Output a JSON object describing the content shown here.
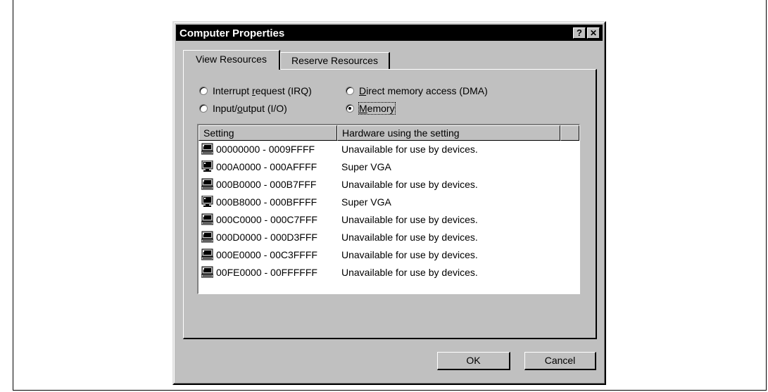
{
  "window": {
    "title": "Computer Properties",
    "help_glyph": "?",
    "close_glyph": "✕"
  },
  "tabs": [
    {
      "label": "View Resources",
      "active": true
    },
    {
      "label": "Reserve Resources",
      "active": false
    }
  ],
  "radios": {
    "irq": {
      "pre": "Interrupt ",
      "mnemonic": "r",
      "post": "equest (IRQ)",
      "checked": false
    },
    "io": {
      "pre": "Input/",
      "mnemonic": "o",
      "post": "utput (I/O)",
      "checked": false
    },
    "dma": {
      "pre": "",
      "mnemonic": "D",
      "post": "irect memory access (DMA)",
      "checked": false
    },
    "memory": {
      "pre": "",
      "mnemonic": "M",
      "post": "emory",
      "checked": true
    }
  },
  "list": {
    "columns": [
      "Setting",
      "Hardware using the setting"
    ],
    "rows": [
      {
        "setting": "00000000 - 0009FFFF",
        "hardware": "Unavailable for use by devices.",
        "icon": "computer-icon"
      },
      {
        "setting": "000A0000 - 000AFFFF",
        "hardware": "Super VGA",
        "icon": "monitor-icon"
      },
      {
        "setting": "000B0000 - 000B7FFF",
        "hardware": "Unavailable for use by devices.",
        "icon": "computer-icon"
      },
      {
        "setting": "000B8000 - 000BFFFF",
        "hardware": "Super VGA",
        "icon": "monitor-icon"
      },
      {
        "setting": "000C0000 - 000C7FFF",
        "hardware": "Unavailable for use by devices.",
        "icon": "computer-icon"
      },
      {
        "setting": "000D0000 - 000D3FFF",
        "hardware": "Unavailable for use by devices.",
        "icon": "computer-icon"
      },
      {
        "setting": "000E0000 - 00C3FFFF",
        "hardware": "Unavailable for use by devices.",
        "icon": "computer-icon"
      },
      {
        "setting": "00FE0000 - 00FFFFFF",
        "hardware": "Unavailable for use by devices.",
        "icon": "computer-icon"
      }
    ]
  },
  "buttons": {
    "ok": "OK",
    "cancel": "Cancel"
  }
}
